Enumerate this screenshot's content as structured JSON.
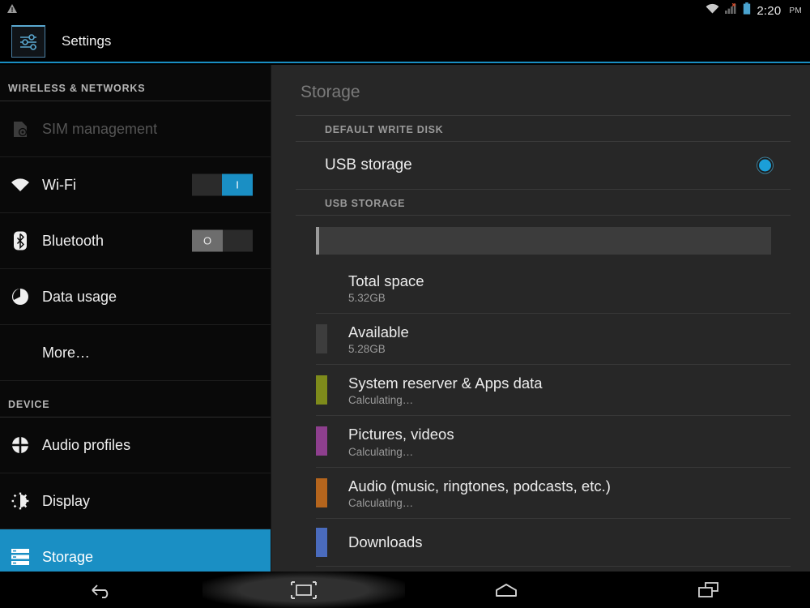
{
  "status_bar": {
    "warning_icon": "warning-triangle-icon",
    "wifi_icon": "wifi-icon",
    "signal_icon": "signal-no-service-icon",
    "battery_icon": "battery-icon",
    "time": "2:20",
    "ampm": "PM"
  },
  "action_bar": {
    "icon": "settings-sliders-icon",
    "title": "Settings"
  },
  "sidebar": {
    "sections": [
      {
        "header": "WIRELESS & NETWORKS",
        "items": [
          {
            "label": "SIM management",
            "icon": "sim-card-icon",
            "state": "disabled",
            "toggle": null
          },
          {
            "label": "Wi-Fi",
            "icon": "wifi-icon",
            "state": "normal",
            "toggle": "on",
            "toggle_on_label": "I"
          },
          {
            "label": "Bluetooth",
            "icon": "bluetooth-icon",
            "state": "normal",
            "toggle": "off",
            "toggle_off_label": "O"
          },
          {
            "label": "Data usage",
            "icon": "data-usage-pie-icon",
            "state": "normal",
            "toggle": null
          },
          {
            "label": "More…",
            "icon": null,
            "state": "normal",
            "toggle": null
          }
        ]
      },
      {
        "header": "DEVICE",
        "items": [
          {
            "label": "Audio profiles",
            "icon": "audio-profiles-icon",
            "state": "normal",
            "toggle": null
          },
          {
            "label": "Display",
            "icon": "display-brightness-icon",
            "state": "normal",
            "toggle": null
          },
          {
            "label": "Storage",
            "icon": "storage-list-icon",
            "state": "selected",
            "toggle": null
          }
        ]
      }
    ]
  },
  "content": {
    "title": "Storage",
    "default_write_disk": {
      "header": "DEFAULT WRITE DISK",
      "option_label": "USB storage",
      "selected": true
    },
    "usb_storage": {
      "header": "USB STORAGE",
      "usage_bar": {
        "segments": [
          {
            "name": "used",
            "color": "#9b9b9b",
            "percent": 0.8
          }
        ],
        "track_color": "#3c3c3c"
      },
      "items": [
        {
          "label": "Total space",
          "value": "5.32GB",
          "color": null
        },
        {
          "label": "Available",
          "value": "5.28GB",
          "color": "#3d3d3d"
        },
        {
          "label": "System reserver & Apps data",
          "value": "Calculating…",
          "color": "#7e8b1b"
        },
        {
          "label": "Pictures, videos",
          "value": "Calculating…",
          "color": "#8e3f8e"
        },
        {
          "label": "Audio (music, ringtones, podcasts, etc.)",
          "value": "Calculating…",
          "color": "#b5651d"
        },
        {
          "label": "Downloads",
          "value": "",
          "color": "#4a6bbd"
        }
      ]
    }
  },
  "nav_bar": {
    "buttons": [
      {
        "name": "back-icon",
        "label": "Back"
      },
      {
        "name": "screenshot-icon",
        "label": "Screenshot",
        "highlighted": true
      },
      {
        "name": "home-icon",
        "label": "Home"
      },
      {
        "name": "recents-icon",
        "label": "Recent apps"
      }
    ]
  },
  "colors": {
    "accent": "#1a8fc4",
    "sidebar_bg": "#090909",
    "content_bg": "#272727"
  }
}
